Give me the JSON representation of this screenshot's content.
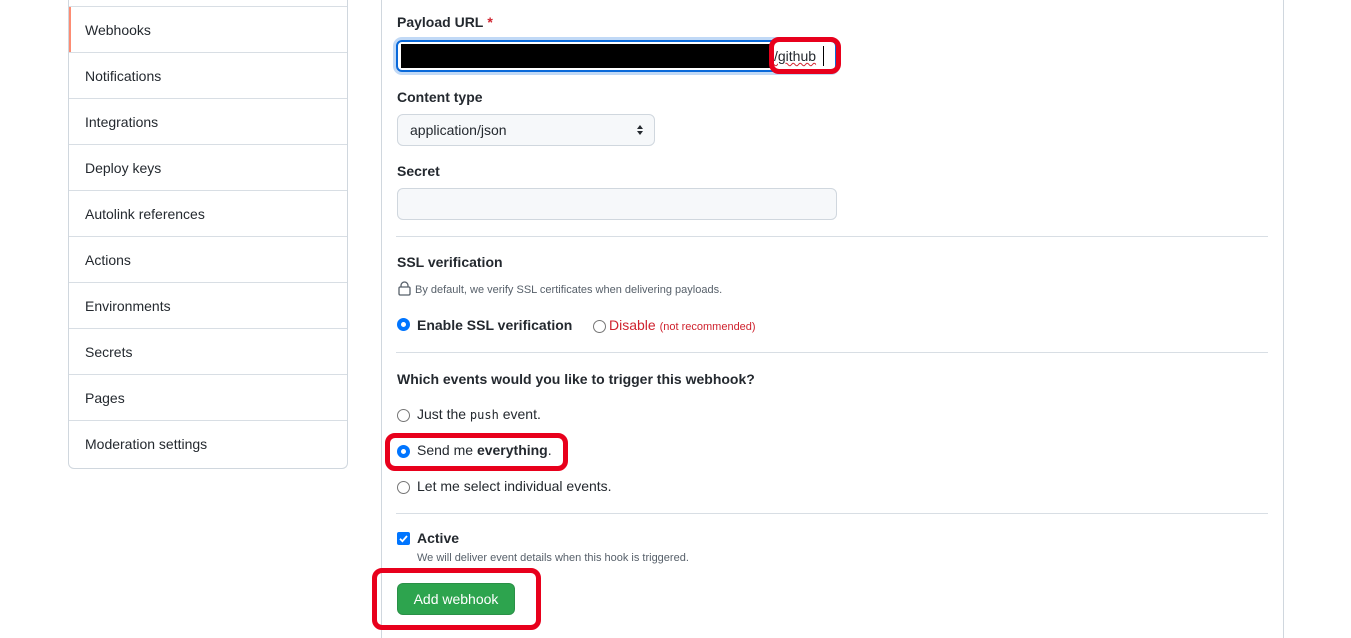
{
  "sidebar": {
    "items": [
      {
        "label": "Webhooks",
        "selected": true
      },
      {
        "label": "Notifications"
      },
      {
        "label": "Integrations"
      },
      {
        "label": "Deploy keys"
      },
      {
        "label": "Autolink references"
      },
      {
        "label": "Actions"
      },
      {
        "label": "Environments"
      },
      {
        "label": "Secrets"
      },
      {
        "label": "Pages"
      },
      {
        "label": "Moderation settings"
      }
    ]
  },
  "form": {
    "payload_url": {
      "label": "Payload URL",
      "required_mark": "*",
      "value_visible": "/github"
    },
    "content_type": {
      "label": "Content type",
      "selected": "application/json"
    },
    "secret": {
      "label": "Secret",
      "value": ""
    },
    "ssl": {
      "label": "SSL verification",
      "note": "By default, we verify SSL certificates when delivering payloads.",
      "enable_label": "Enable SSL verification",
      "disable_label": "Disable",
      "disable_note": "(not recommended)"
    },
    "events": {
      "question": "Which events would you like to trigger this webhook?",
      "just_push_prefix": "Just the ",
      "just_push_code": "push",
      "just_push_suffix": " event.",
      "everything_prefix": "Send me ",
      "everything_bold": "everything",
      "everything_suffix": ".",
      "select_individual": "Let me select individual events."
    },
    "active": {
      "label": "Active",
      "note": "We will deliver event details when this hook is triggered.",
      "checked": true
    },
    "submit_label": "Add webhook"
  },
  "colors": {
    "accent": "#0969da",
    "radio_checked": "#0075ff",
    "danger": "#cf222e",
    "success_button": "#2da44e",
    "annotation": "#e8001c"
  }
}
